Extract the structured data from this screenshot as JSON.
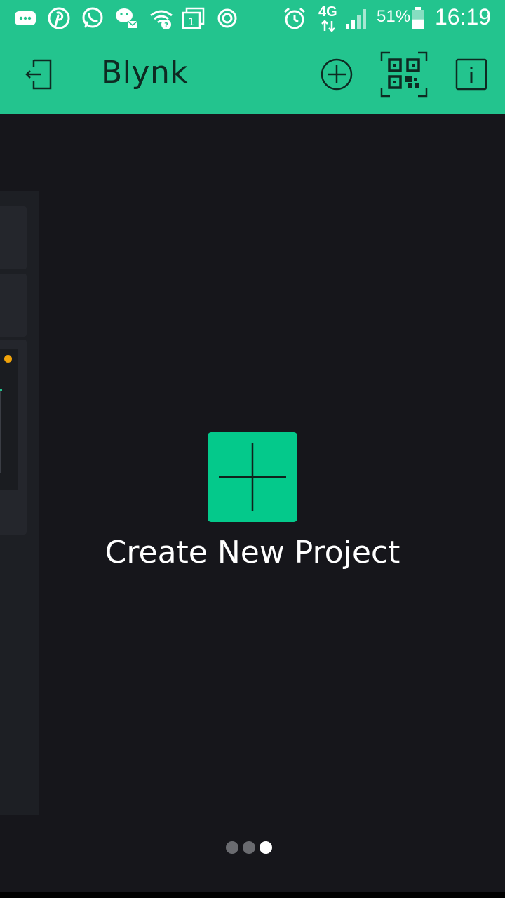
{
  "status_bar": {
    "icons": [
      "message-icon",
      "pinterest-icon",
      "whatsapp-icon",
      "wechat-icon",
      "wifi-icon",
      "sim-card-icon",
      "sync-icon",
      "alarm-icon",
      "signal-icon",
      "battery-icon"
    ],
    "network": "4G",
    "battery_percent": "51%",
    "battery_level": 0.51,
    "time": "16:19"
  },
  "app_bar": {
    "title": "Blynk",
    "icons": [
      "logout-icon",
      "add-circle-icon",
      "qr-scan-icon",
      "info-icon"
    ]
  },
  "main": {
    "create_project_label": "Create New Project",
    "create_project_icon": "plus-icon"
  },
  "pager": {
    "pages": 3,
    "active_page": 3
  },
  "colors": {
    "accent": "#23c48e",
    "create_button": "#04c98b",
    "background": "#16161b",
    "widget_dot": "#f0a30a"
  }
}
